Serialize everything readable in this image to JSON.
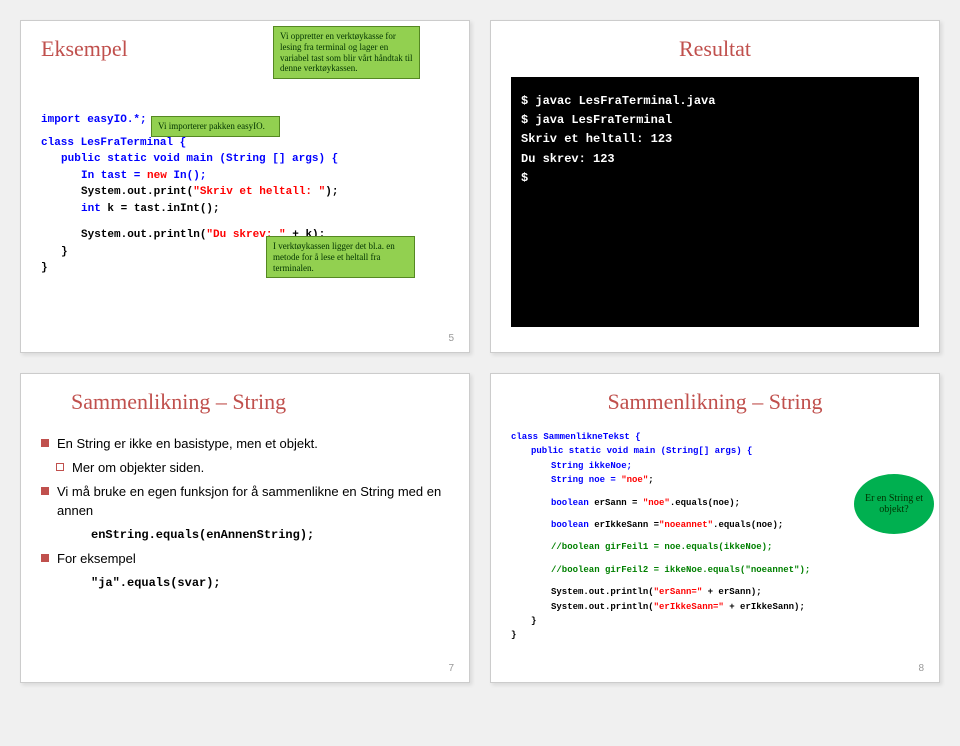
{
  "slide5": {
    "title": "Eksempel",
    "callout1b_text": "Vi importerer pakken easyIO.",
    "callout1_text": "Vi oppretter en verktøykasse for lesing fra terminal og lager en variabel tast som blir vårt håndtak til denne verktøykassen.",
    "callout2_text": "I verktøykassen ligger det bl.a. en metode for å lese et heltall fra terminalen.",
    "code": {
      "l1a": "import easyIO.*;",
      "l2a": "class LesFraTerminal {",
      "l3a": "public static void main (String [] args) {",
      "l4a": "In tast = ",
      "l4b": "new",
      "l4c": " In();",
      "l5a": "System.out.print(",
      "l5b": "\"Skriv et heltall: \"",
      "l5c": ");",
      "l6a": "int",
      "l6b": " k = tast.inInt();",
      "l7a": "System.out.println(",
      "l7b": "\"Du skrev: \"",
      "l7c": " + k);",
      "l8": "}",
      "l9": "}"
    },
    "pagenum": "5"
  },
  "slide6": {
    "title": "Resultat",
    "term": {
      "l1": "$ javac   LesFraTerminal.java",
      "l2": "$ java   LesFraTerminal",
      "l3": "Skriv et heltall: 123",
      "l4": "Du skrev: 123",
      "l5": "",
      "l6": "$"
    }
  },
  "slide7": {
    "title": "Sammenlikning – String",
    "b1": "En String er ikke en basistype, men et objekt.",
    "b1a": "Mer om objekter siden.",
    "b2": "Vi må bruke en egen funksjon for å sammenlikne en String med en annen",
    "code1": "enString.equals(enAnnenString);",
    "b3": "For eksempel",
    "code2": "\"ja\".equals(svar);",
    "pagenum": "7"
  },
  "slide8": {
    "title": "Sammenlikning – String",
    "callout3_text": "Er en String et objekt?",
    "code": {
      "l1": "class SammenlikneTekst {",
      "l2a": "public static void main (String[] args) {",
      "l3": "String ikkeNoe;",
      "l4a": "String noe = ",
      "l4b": "\"noe\"",
      "l4c": ";",
      "l5a": "boolean",
      "l5b": " erSann = ",
      "l5c": "\"noe\"",
      "l5d": ".equals(noe);",
      "l6a": "boolean",
      "l6b": " erIkkeSann =",
      "l6c": "\"noeannet\"",
      "l6d": ".equals(noe);",
      "l7": "//boolean girFeil1 = noe.equals(ikkeNoe);",
      "l8": "//boolean girFeil2 = ikkeNoe.equals(\"noeannet\");",
      "l9a": "System.out.println(",
      "l9b": "\"erSann=\"",
      "l9c": " + erSann);",
      "l10a": "System.out.println(",
      "l10b": "\"erIkkeSann=\"",
      "l10c": " + erIkkeSann);",
      "l11": "}",
      "l12": "}"
    },
    "pagenum": "8"
  }
}
